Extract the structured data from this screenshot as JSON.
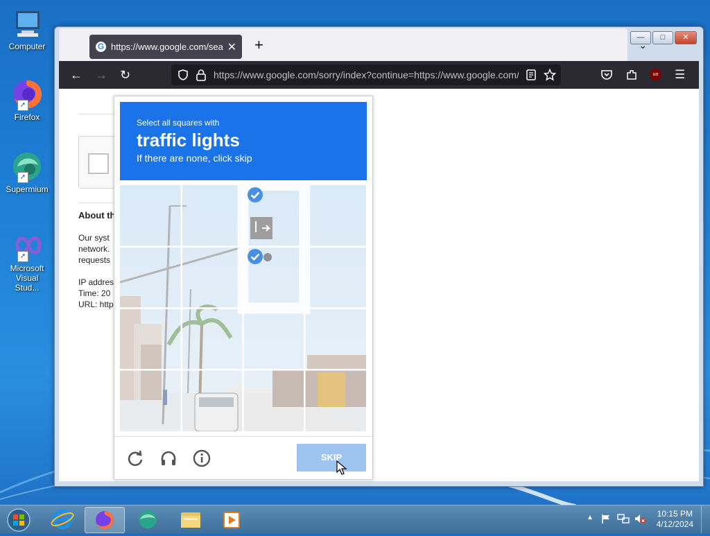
{
  "desktop": {
    "icons": [
      {
        "label": "Computer",
        "icon": "computer-icon"
      },
      {
        "label": "Firefox",
        "icon": "firefox-icon"
      },
      {
        "label": "Supermium",
        "icon": "supermium-icon"
      },
      {
        "label": "Microsoft Visual Stud...",
        "icon": "visual-studio-icon"
      }
    ]
  },
  "browser": {
    "tab_title": "https://www.google.com/search",
    "url": "https://www.google.com/sorry/index?continue=https://www.google.com/search"
  },
  "page": {
    "about_heading": "About th",
    "line1": "Our syst",
    "line2": "network.",
    "line3": "requests",
    "ip_label": "IP addres",
    "time_label": "Time: 20",
    "url_label": "URL: http"
  },
  "captcha": {
    "instruction": "Select all squares with",
    "target": "traffic lights",
    "sub": "If there are none, click skip",
    "skip_label": "SKIP",
    "selected_tiles": [
      2,
      6
    ],
    "colors": {
      "header": "#1a73e8",
      "check": "#4a90e2",
      "skip": "#9fc3ef"
    }
  },
  "taskbar": {
    "items": [
      "start-orb",
      "internet-explorer-icon",
      "firefox-icon",
      "supermium-icon",
      "file-explorer-icon",
      "media-player-icon"
    ],
    "time": "10:15 PM",
    "date": "4/12/2024"
  }
}
